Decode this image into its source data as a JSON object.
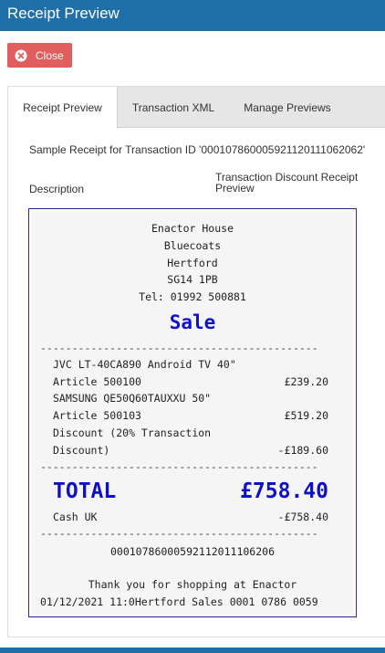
{
  "window": {
    "title": "Receipt Preview"
  },
  "close_button": {
    "label": "Close",
    "icon": "close-circle-icon"
  },
  "tabs": [
    {
      "label": "Receipt Preview",
      "active": true
    },
    {
      "label": "Transaction XML",
      "active": false
    },
    {
      "label": "Manage Previews",
      "active": false
    }
  ],
  "sample_text": "Sample Receipt for Transaction ID '000107860005921120111062062'",
  "columns": {
    "description": "Description",
    "receipt": "Transaction Discount Receipt Preview"
  },
  "receipt": {
    "header_lines": [
      "Enactor House",
      "Bluecoats",
      "Hertford",
      "SG14 1PB",
      "Tel: 01992 500881"
    ],
    "sale_title": "Sale",
    "dashes": "--------------------------------------------",
    "items": [
      {
        "line1": "JVC LT-40CA890 Android TV 40\"",
        "line2": "Article 500100",
        "amount": "£239.20"
      },
      {
        "line1": "SAMSUNG QE50Q60TAUXXU 50\"",
        "line2": "Article 500103",
        "amount": "£519.20"
      }
    ],
    "discount": {
      "line1": "Discount (20% Transaction",
      "line2": "Discount)",
      "amount": "-£189.60"
    },
    "total_label": "TOTAL",
    "total_amount": "£758.40",
    "tender": {
      "label": "Cash UK",
      "amount": "-£758.40"
    },
    "barcode_number": "00010786000592112011106206",
    "thank_you": "Thank you for shopping at Enactor",
    "footer_line": "01/12/2021 11:0Hertford Sales 0001 0786 0059"
  },
  "colors": {
    "title_bar": "#1f6fa8",
    "close_button": "#e05e5e",
    "receipt_accent": "#1010c8"
  }
}
